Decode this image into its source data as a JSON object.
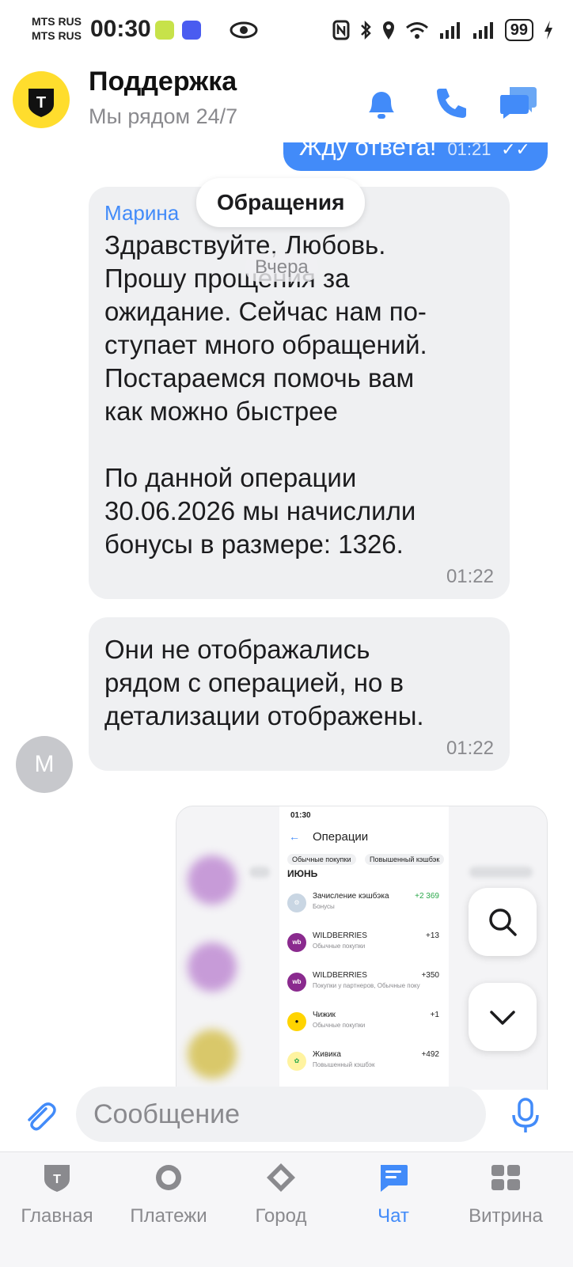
{
  "status_bar": {
    "carrier_1": "MTS RUS",
    "carrier_2": "MTS RUS",
    "time": "00:30",
    "battery": "99"
  },
  "header": {
    "title": "Поддержка",
    "subtitle": "Мы рядом 24/7",
    "logo_letter": "T",
    "icons": [
      "bell-icon",
      "phone-icon",
      "chat-icon"
    ]
  },
  "chat": {
    "outgoing_partial": {
      "text": "Жду ответа!",
      "time": "01:21"
    },
    "pill_label": "Обращения",
    "date_chip": "Вчера",
    "messages": [
      {
        "author": "Марина",
        "text": "Здравствуйте, Любовь.\nПрошу прощения за\nожидание. Сейчас нам по-\nступает много обращений.\nПостараемся помочь вам\nкак можно быстрее\n\nПо данной операции\n30.06.2026 мы начислили\nбонусы в размере: 1326.",
        "time": "01:22"
      },
      {
        "author": "",
        "text": "Они не отображались\nрядом с операцией, но в\nдетализации отображены.",
        "time": "01:22"
      }
    ],
    "agent_avatar_letter": "М",
    "attachment": {
      "status_time": "01:30",
      "title": "Операции",
      "tabs": [
        "Обычные покупки",
        "Повышенный кэшбэк"
      ],
      "month": "ИЮНЬ",
      "rows": [
        {
          "name": "Зачисление кэшбэка",
          "category": "Бонусы",
          "amount": "+2 369",
          "icon_text": "",
          "icon_color": "#c9d6e3"
        },
        {
          "name": "WILDBERRIES",
          "category": "Обычные покупки",
          "amount": "+13",
          "icon_text": "wb",
          "icon_color": "#8a2a8e"
        },
        {
          "name": "WILDBERRIES",
          "category": "Покупки у партнеров, Обычные поку",
          "amount": "+350",
          "icon_text": "wb",
          "icon_color": "#8a2a8e"
        },
        {
          "name": "Чижик",
          "category": "Обычные покупки",
          "amount": "+1",
          "icon_text": "",
          "icon_color": "#ffd400"
        },
        {
          "name": "Живика",
          "category": "Повышенный кэшбэк",
          "amount": "+492",
          "icon_text": "",
          "icon_color": "#fff3a0"
        }
      ]
    }
  },
  "input": {
    "placeholder": "Сообщение",
    "value": ""
  },
  "tabbar": {
    "items": [
      {
        "label": "Главная",
        "icon": "shield-icon",
        "active": false
      },
      {
        "label": "Платежи",
        "icon": "circle-icon",
        "active": false
      },
      {
        "label": "Город",
        "icon": "diamond-icon",
        "active": false
      },
      {
        "label": "Чат",
        "icon": "chat-icon",
        "active": true
      },
      {
        "label": "Витрина",
        "icon": "grid-icon",
        "active": false
      }
    ]
  },
  "colors": {
    "accent": "#428bf9",
    "bubble_in": "#eff0f2",
    "brand_yellow": "#ffdd2d"
  }
}
